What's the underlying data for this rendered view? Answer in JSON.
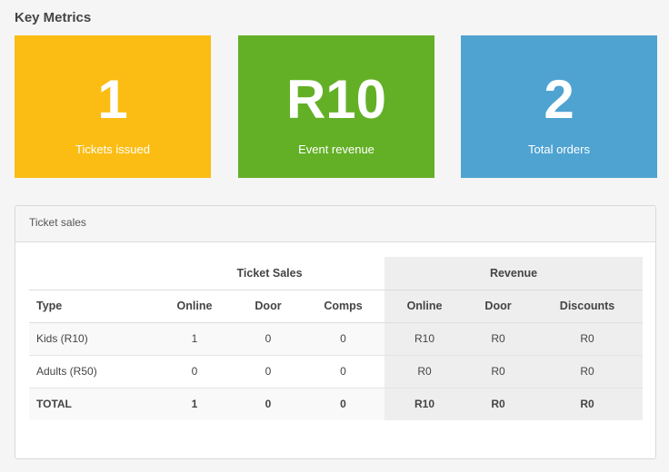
{
  "section_title": "Key Metrics",
  "metrics": [
    {
      "value": "1",
      "label": "Tickets issued",
      "color": "#fbbd14"
    },
    {
      "value": "R10",
      "label": "Event revenue",
      "color": "#63b026"
    },
    {
      "value": "2",
      "label": "Total orders",
      "color": "#4fa3d1"
    }
  ],
  "panel": {
    "heading": "Ticket sales",
    "groups": {
      "ticket_sales": "Ticket Sales",
      "revenue": "Revenue"
    },
    "columns": [
      "Type",
      "Online",
      "Door",
      "Comps",
      "Online",
      "Door",
      "Discounts"
    ],
    "rows": [
      [
        "Kids (R10)",
        "1",
        "0",
        "0",
        "R10",
        "R0",
        "R0"
      ],
      [
        "Adults (R50)",
        "0",
        "0",
        "0",
        "R0",
        "R0",
        "R0"
      ]
    ],
    "total": [
      "TOTAL",
      "1",
      "0",
      "0",
      "R10",
      "R0",
      "R0"
    ]
  }
}
